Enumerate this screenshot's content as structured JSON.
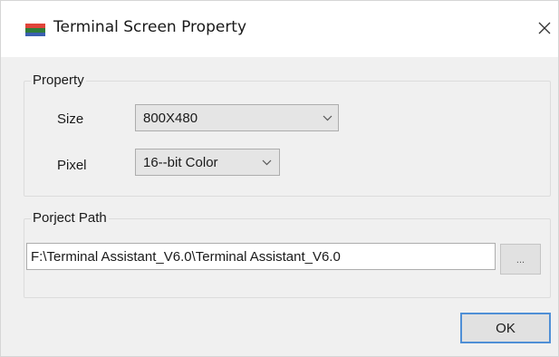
{
  "window": {
    "title": "Terminal Screen Property",
    "icon": "terminal-screen-app-icon",
    "close_icon": "close-icon"
  },
  "property_group": {
    "label": "Property",
    "size": {
      "label": "Size",
      "value": "800X480"
    },
    "pixel": {
      "label": "Pixel",
      "value": "16--bit Color"
    }
  },
  "project_path_group": {
    "label": "Porject Path",
    "path_value": "F:\\Terminal Assistant_V6.0\\Terminal Assistant_V6.0",
    "browse_label": "..."
  },
  "ok_label": "OK",
  "colors": {
    "accent": "#4f8fd6",
    "dialog_bg": "#f0f0f0",
    "titlebar_bg": "#ffffff"
  }
}
